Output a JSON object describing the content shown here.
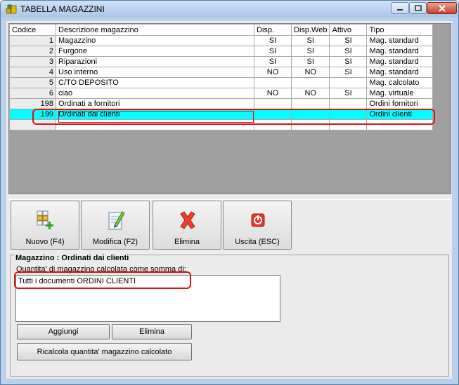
{
  "window": {
    "title": "TABELLA MAGAZZINI"
  },
  "grid": {
    "columns": [
      "Codice",
      "Descrizione magazzino",
      "Disp.",
      "Disp.Web",
      "Attivo",
      "Tipo"
    ],
    "rows": [
      {
        "code": "1",
        "desc": "Magazzino",
        "disp": "SI",
        "web": "SI",
        "attivo": "SI",
        "tipo": "Mag. standard"
      },
      {
        "code": "2",
        "desc": "Furgone",
        "disp": "SI",
        "web": "SI",
        "attivo": "SI",
        "tipo": "Mag. standard"
      },
      {
        "code": "3",
        "desc": "Riparazioni",
        "disp": "SI",
        "web": "SI",
        "attivo": "SI",
        "tipo": "Mag. standard"
      },
      {
        "code": "4",
        "desc": "Uso interno",
        "disp": "NO",
        "web": "NO",
        "attivo": "SI",
        "tipo": "Mag. standard"
      },
      {
        "code": "5",
        "desc": "C/TO DEPOSITO",
        "disp": "",
        "web": "",
        "attivo": "",
        "tipo": "Mag. calcolato"
      },
      {
        "code": "6",
        "desc": "ciao",
        "disp": "NO",
        "web": "NO",
        "attivo": "SI",
        "tipo": "Mag. virtuale"
      },
      {
        "code": "198",
        "desc": "Ordinati a fornitori",
        "disp": "",
        "web": "",
        "attivo": "",
        "tipo": "Ordini fornitori"
      },
      {
        "code": "199",
        "desc": "Ordinati dai clienti",
        "disp": "",
        "web": "",
        "attivo": "",
        "tipo": "Ordini clienti"
      }
    ],
    "selected_index": 7
  },
  "toolbar": {
    "new_label": "Nuovo (F4)",
    "edit_label": "Modifica (F2)",
    "delete_label": "Elimina",
    "exit_label": "Uscita (ESC)"
  },
  "detail": {
    "group_title": "Magazzino : Ordinati dai clienti",
    "sum_label": "Quantita' di magazzino calcolata come somma di:",
    "memo_text": "Tutti i documenti ORDINI CLIENTI",
    "add_label": "Aggiungi",
    "remove_label": "Elimina",
    "recalc_label": "Ricalcola quantita' magazzino calcolato"
  },
  "colors": {
    "selection": "#00ffff",
    "highlight": "#e01010"
  }
}
